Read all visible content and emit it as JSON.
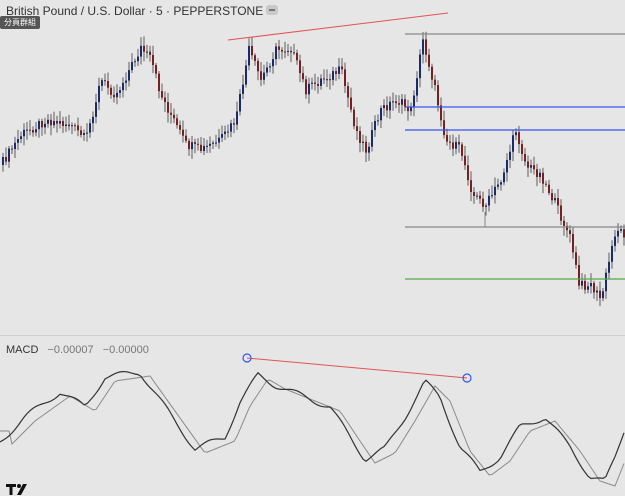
{
  "header": {
    "title": "British Pound / U.S. Dollar · 5 · PEPPERSTONE",
    "tag": "分頁群組"
  },
  "indicator": {
    "name": "MACD",
    "value1": "−0.00007",
    "value2": "−0.00000"
  },
  "colors": {
    "background": "#e6e6e6",
    "candle_up": "#1a2a6e",
    "candle_down": "#7a1f1f",
    "wick": "#222222",
    "line_red": "#e05555",
    "line_blue": "#3355ee",
    "line_gray": "#888888",
    "line_green": "#55aa44",
    "macd_line": "#333333",
    "signal_line": "#8a8a8a"
  },
  "icons": [
    "collapse-icon",
    "tradingview-logo-icon"
  ]
}
